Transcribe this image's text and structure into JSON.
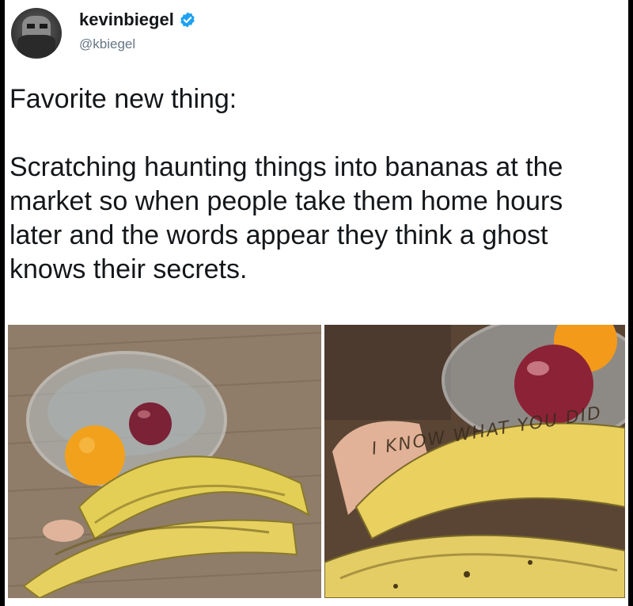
{
  "tweet": {
    "display_name": "kevinbiegel",
    "handle": "@kbiegel",
    "verified": true,
    "paragraphs": [
      "Favorite new thing:",
      "Scratching haunting things into bananas at the market so when people take them home hours later and the words appear they think a ghost knows their secrets."
    ]
  },
  "media": {
    "right_photo_banana_text": "I KNOW WHAT YOU DID"
  },
  "icons": {
    "verified": "verified-badge-icon",
    "avatar": "avatar"
  },
  "colors": {
    "verified_blue": "#1da1f2",
    "handle_gray": "#657786",
    "text": "#14171a"
  }
}
